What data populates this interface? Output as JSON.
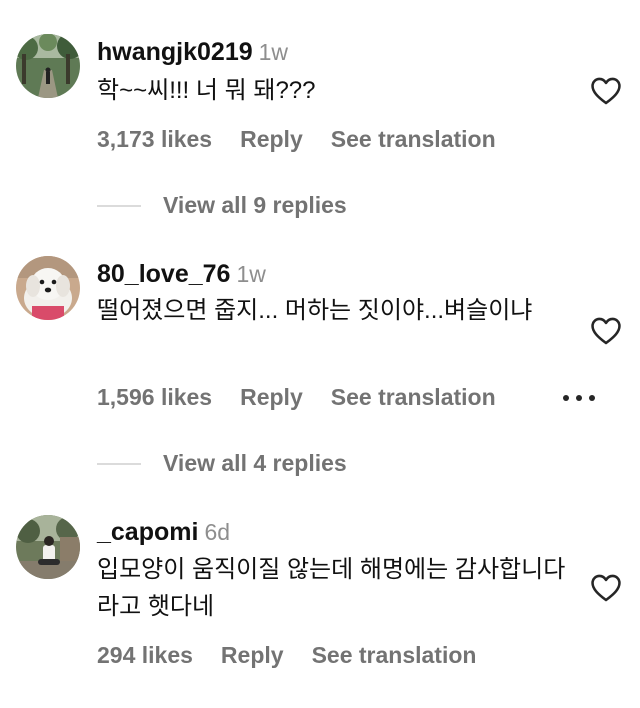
{
  "comments": [
    {
      "username": "hwangjk0219",
      "time": "1w",
      "text": "학~~씨!!! 너 뭐 돼???",
      "likes": "3,173 likes",
      "reply_label": "Reply",
      "translate_label": "See translation",
      "view_replies": "View all 9 replies",
      "avatar_icon": "forest-path-photo"
    },
    {
      "username": "80_love_76",
      "time": "1w",
      "text": "떨어졌으면 줍지... 머하는 짓이야...벼슬이냐",
      "likes": "1,596 likes",
      "reply_label": "Reply",
      "translate_label": "See translation",
      "view_replies": "View all 4 replies",
      "avatar_icon": "white-dog-photo"
    },
    {
      "username": "_capomi",
      "time": "6d",
      "text": "입모양이 움직이질 않는데 해명에는 감사합니다라고 햇다네",
      "likes": "294 likes",
      "reply_label": "Reply",
      "translate_label": "See translation",
      "avatar_icon": "person-sitting-photo"
    }
  ],
  "icons": {
    "like": "heart-outline-icon",
    "more": "more-dots-icon"
  },
  "colors": {
    "text": "#111111",
    "secondary": "#737373",
    "divider": "#dbdbdb"
  }
}
